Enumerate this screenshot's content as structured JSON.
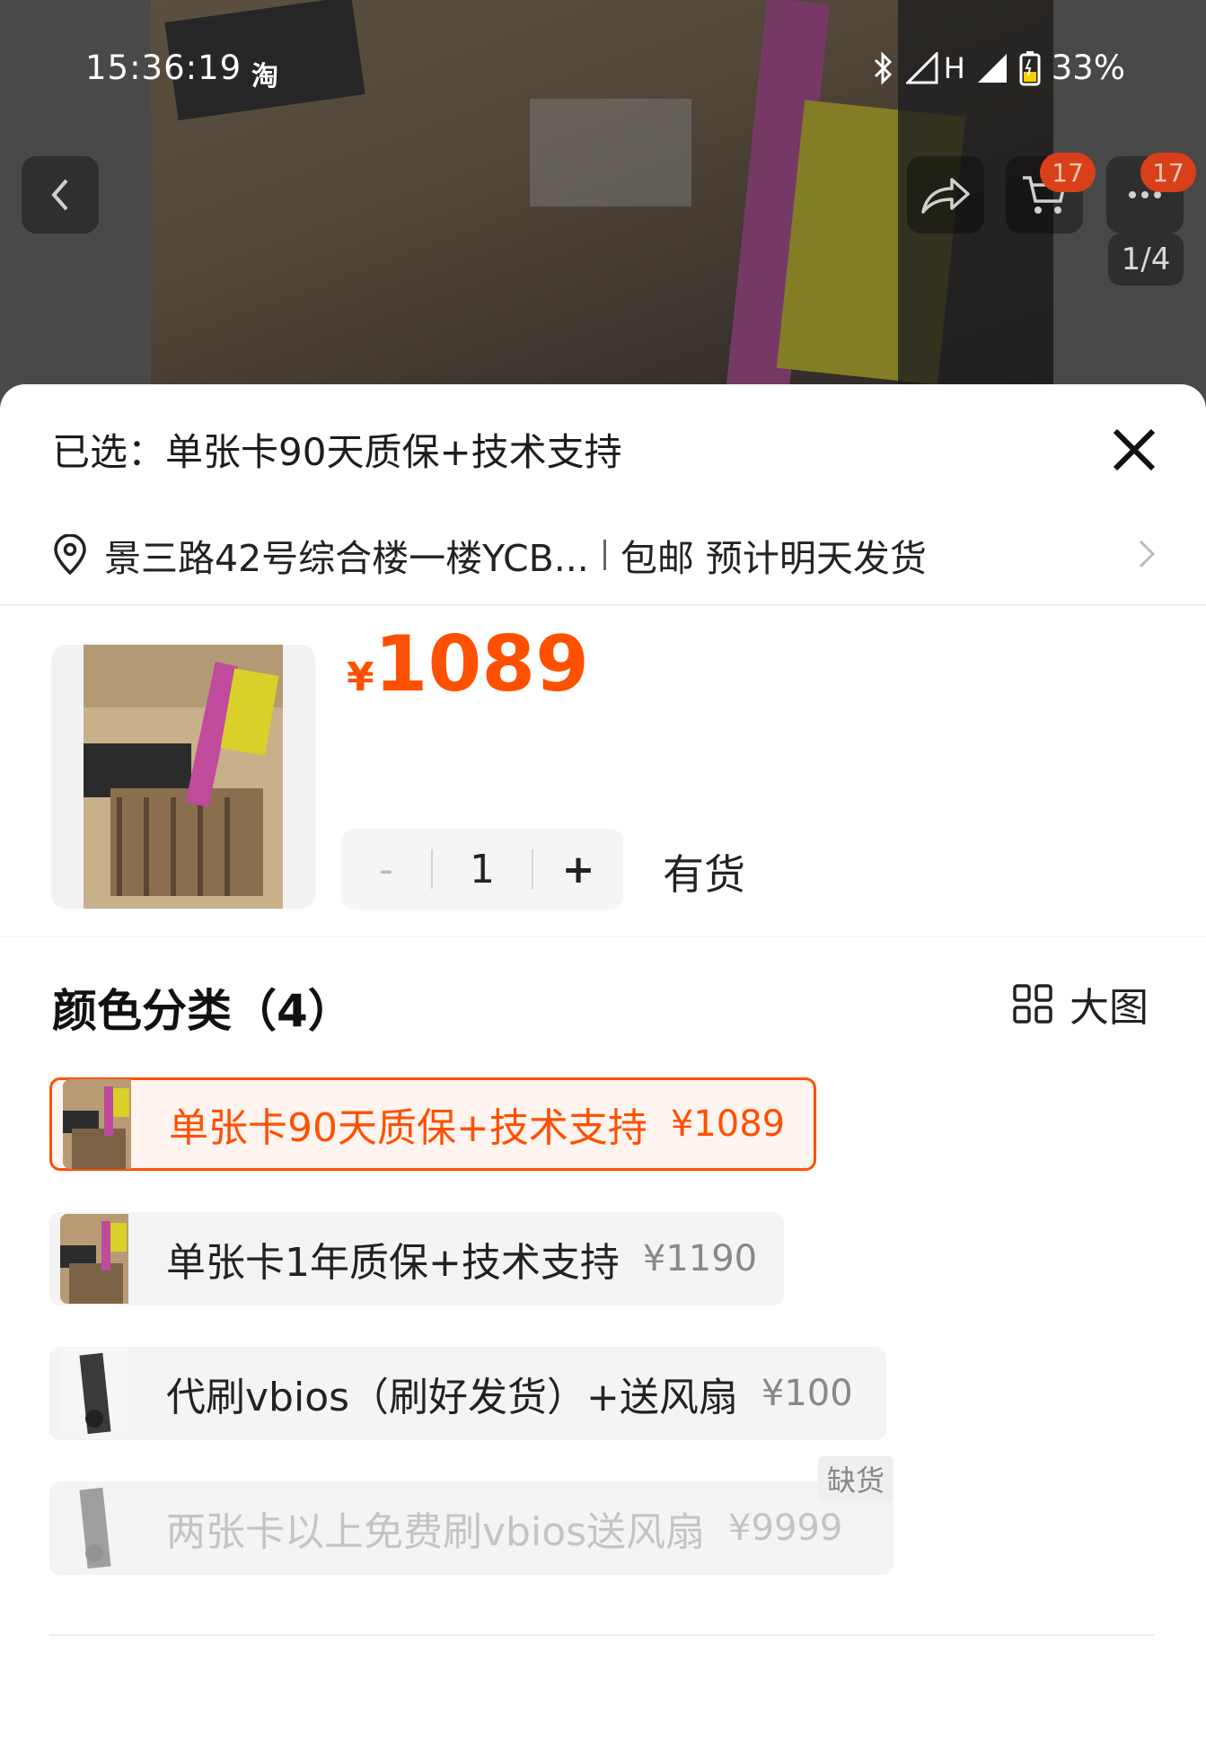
{
  "status_bar": {
    "time": "15:36:19",
    "app_glyph": "淘",
    "network": "H",
    "battery": "33%"
  },
  "top_bar": {
    "cart_badge": "17",
    "more_badge": "17",
    "page_indicator": "1/4"
  },
  "sheet": {
    "selected_text": "已选：单张卡90天质保+技术支持",
    "address": "景三路42号综合楼一楼YCB...",
    "shipping": "包邮 预计明天发货",
    "price_currency": "¥",
    "price_value": "1089",
    "quantity": {
      "minus": "-",
      "value": "1",
      "plus": "+"
    },
    "stock_status": "有货",
    "section_title": "颜色分类（4）",
    "big_view_label": "大图",
    "options": [
      {
        "label": "单张卡90天质保+技术支持",
        "price": "¥1089",
        "state": "selected"
      },
      {
        "label": "单张卡1年质保+技术支持",
        "price": "¥1190",
        "state": "normal"
      },
      {
        "label": "代刷vbios（刷好发货）+送风扇",
        "price": "¥100",
        "state": "normal"
      },
      {
        "label": "两张卡以上免费刷vbios送风扇",
        "price": "¥9999",
        "state": "disabled",
        "tag": "缺货"
      }
    ]
  },
  "colors": {
    "accent": "#ff5000",
    "badge": "#d8401a"
  }
}
